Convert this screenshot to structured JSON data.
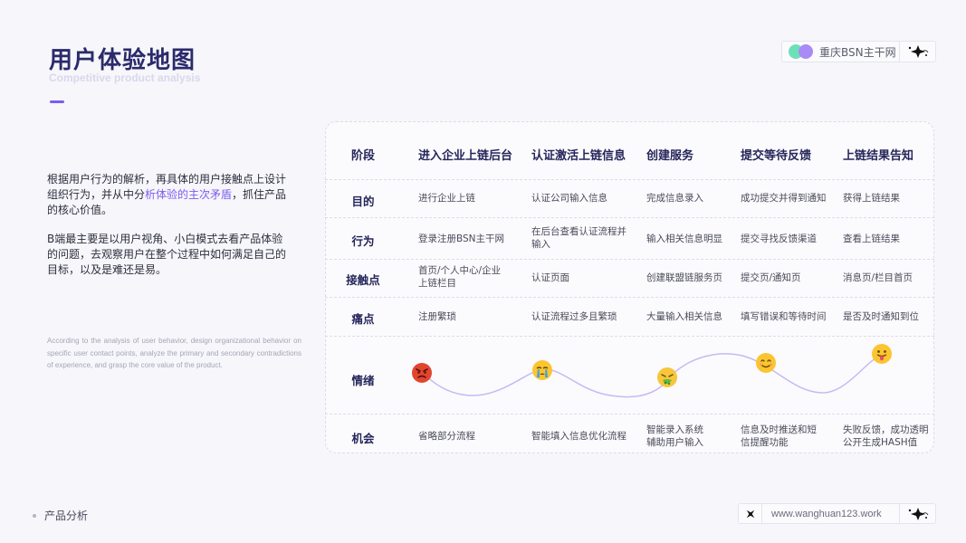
{
  "header": {
    "title": "用户体验地图",
    "subtitle": "Competitive product analysis",
    "brand_text": "重庆BSN主干网"
  },
  "intro": {
    "p1_a": "根据用户行为的解析，再具体的用户接触点上设计组织行为，并从中分",
    "p1_highlight": "析体验的主次矛盾",
    "p1_b": "，抓住产品的核心价值。",
    "p2": "B端最主要是以用户视角、小白模式去看产品体验的问题，去观察用户在整个过程中如何满足自己的目标，以及是难还是易。",
    "english": "According to the analysis of user behavior, design organizational behavior on specific user contact points, analyze the primary and secondary contradictions of experience, and grasp the core value of the product."
  },
  "map": {
    "header_label": "阶段",
    "stages": [
      "进入企业上链后台",
      "认证激活上链信息",
      "创建服务",
      "提交等待反馈",
      "上链结果告知"
    ],
    "rows": [
      {
        "label": "目的",
        "cells": [
          "进行企业上链",
          "认证公司输入信息",
          "完成信息录入",
          "成功提交并得到通知",
          "获得上链结果"
        ]
      },
      {
        "label": "行为",
        "cells": [
          "登录注册BSN主干网",
          "在后台查看认证流程并输入",
          "输入相关信息明显",
          "提交寻找反馈渠道",
          "查看上链结果"
        ]
      },
      {
        "label": "接触点",
        "cells": [
          "首页/个人中心/企业上链栏目",
          "认证页面",
          "创建联盟链服务页",
          "提交页/通知页",
          "消息页/栏目首页"
        ]
      },
      {
        "label": "痛点",
        "cells": [
          "注册繁琐",
          "认证流程过多且繁琐",
          "大量输入相关信息",
          "填写错误和等待时间",
          "是否及时通知到位"
        ]
      }
    ],
    "emotion_label": "情绪",
    "emotions": [
      {
        "icon": "angry-face-icon",
        "level": 2
      },
      {
        "icon": "crying-face-icon",
        "level": 3
      },
      {
        "icon": "sick-face-icon",
        "level": 1
      },
      {
        "icon": "smiling-face-icon",
        "level": 4
      },
      {
        "icon": "tongue-face-icon",
        "level": 5
      }
    ],
    "opportunity": {
      "label": "机会",
      "cells": [
        "省略部分流程",
        "智能填入信息优化流程",
        "智能录入系统辅助用户输入",
        "信息及时推送和短信提醒功能",
        "失败反馈，成功透明公开生成HASH值"
      ]
    }
  },
  "footer": {
    "section": "产品分析",
    "url": "www.wanghuan123.work"
  }
}
